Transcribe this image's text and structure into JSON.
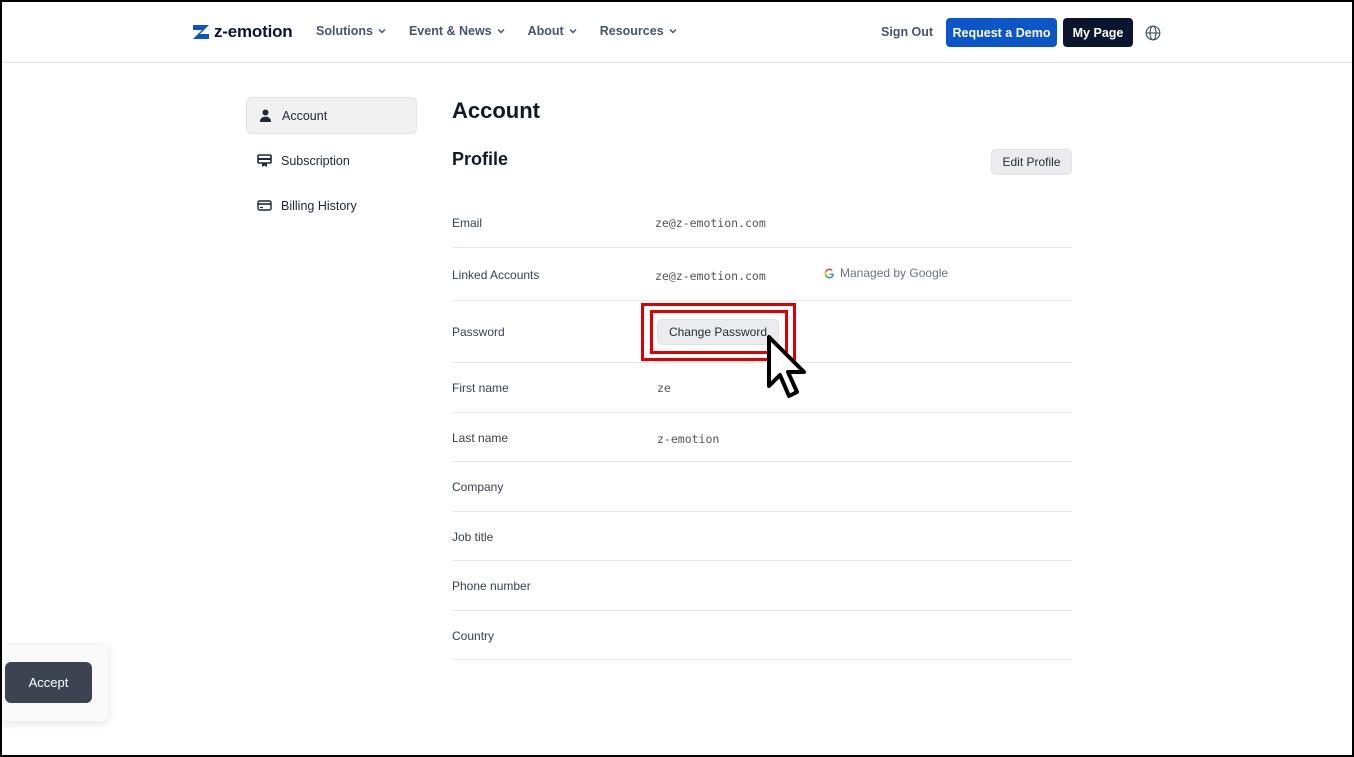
{
  "brand": {
    "name": "z-emotion",
    "accent": "#0b55c9",
    "dark": "#0b1530"
  },
  "nav": {
    "items": [
      {
        "label": "Solutions"
      },
      {
        "label": "Event & News"
      },
      {
        "label": "About"
      },
      {
        "label": "Resources"
      }
    ],
    "sign_out": "Sign Out",
    "request_demo": "Request a Demo",
    "my_page": "My Page"
  },
  "sidebar": {
    "items": [
      {
        "label": "Account",
        "icon": "user-icon",
        "active": true
      },
      {
        "label": "Subscription",
        "icon": "subscription-icon",
        "active": false
      },
      {
        "label": "Billing History",
        "icon": "credit-card-icon",
        "active": false
      }
    ]
  },
  "main": {
    "title": "Account",
    "section_title": "Profile",
    "edit_profile": "Edit Profile",
    "rows": {
      "email": {
        "label": "Email",
        "value": "ze@z-emotion.com"
      },
      "linked": {
        "label": "Linked Accounts",
        "value": "ze@z-emotion.com",
        "managed": "Managed by Google"
      },
      "password": {
        "label": "Password",
        "button": "Change Password"
      },
      "first_name": {
        "label": "First name",
        "value": "ze"
      },
      "last_name": {
        "label": "Last name",
        "value": "z-emotion"
      },
      "company": {
        "label": "Company",
        "value": ""
      },
      "job_title": {
        "label": "Job title",
        "value": ""
      },
      "phone": {
        "label": "Phone number",
        "value": ""
      },
      "country": {
        "label": "Country",
        "value": ""
      }
    }
  },
  "cookie": {
    "accept": "Accept"
  },
  "highlight_color": "#e10000"
}
